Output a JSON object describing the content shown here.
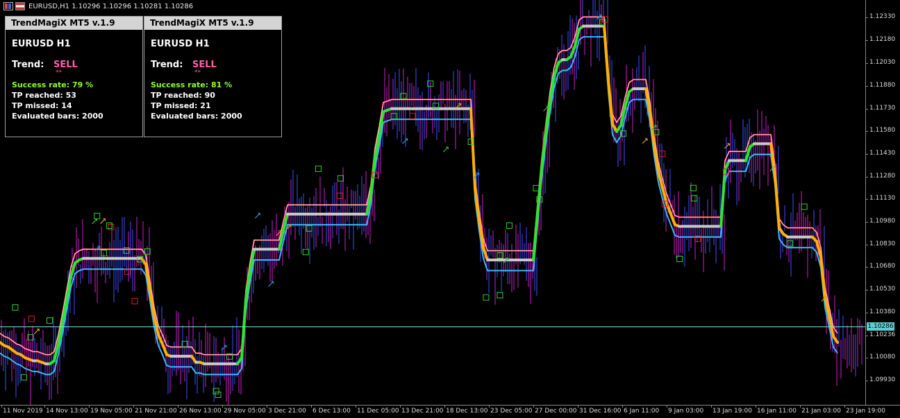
{
  "header": {
    "title": "EURUSD,H1  1.10296 1.10296 1.10281 1.10286"
  },
  "panels": [
    {
      "title": "TrendMagiX MT5 v.1.9",
      "symbol": "EURUSD H1",
      "trend_label": "Trend:",
      "trend_value": "SELL",
      "stars": "**",
      "success_rate": "Success rate: 79 %",
      "tp_reached": "TP reached: 53",
      "tp_missed": "TP missed:  14",
      "evaluated_bars": "Evaluated bars: 2000"
    },
    {
      "title": "TrendMagiX MT5 v.1.9",
      "symbol": "EURUSD H1",
      "trend_label": "Trend:",
      "trend_value": "SELL",
      "stars": "**",
      "success_rate": "Success rate: 81 %",
      "tp_reached": "TP reached: 90",
      "tp_missed": "TP missed:  21",
      "evaluated_bars": "Evaluated bars: 2000"
    }
  ],
  "price_axis": [
    "1.12330",
    "1.12180",
    "1.12030",
    "1.11880",
    "1.11730",
    "1.11580",
    "1.11430",
    "1.11280",
    "1.11130",
    "1.10980",
    "1.10830",
    "1.10680",
    "1.10530",
    "1.10380",
    "1.10236",
    "1.10080",
    "1.09930"
  ],
  "time_axis": [
    "11 Nov 2019",
    "14 Nov 13:00",
    "19 Nov 05:00",
    "21 Nov 21:00",
    "26 Nov 13:00",
    "29 Nov 05:00",
    "3 Dec 21:00",
    "6 Dec 13:00",
    "11 Dec 05:00",
    "13 Dec 21:00",
    "18 Dec 13:00",
    "23 Dec 05:00",
    "27 Dec 00:00",
    "31 Dec 16:00",
    "6 Jan 11:00",
    "9 Jan 03:00",
    "13 Jan 19:00",
    "16 Jan 11:00",
    "21 Jan 03:00",
    "23 Jan 19:00"
  ],
  "current_price": "1.10286",
  "colors": {
    "buy_line": "#2ee52e",
    "sell_line": "#ffb000",
    "neutral": "#c8c8c8",
    "band_up": "#3db8ff",
    "band_down": "#ff3a5a",
    "candle_up": "#4050ff",
    "candle_down": "#d020d0"
  },
  "chart_data": {
    "type": "line",
    "ylim": [
      1.0985,
      1.1239
    ],
    "x": [
      0,
      6,
      12,
      18,
      24,
      30,
      36,
      42,
      48,
      54,
      60,
      66,
      72,
      78,
      84,
      90,
      96,
      102,
      108,
      114,
      120,
      126,
      132,
      138,
      144,
      150,
      156,
      162,
      168,
      174,
      180,
      186,
      192,
      198,
      204,
      210,
      216,
      222,
      228,
      234,
      240,
      246,
      252,
      258,
      264,
      270,
      276,
      282,
      288,
      294,
      300,
      306,
      312,
      318,
      324,
      330,
      336,
      342,
      348,
      354,
      360,
      366,
      372,
      378,
      384,
      390,
      396,
      402,
      408,
      414,
      420,
      426,
      432,
      438,
      444,
      450,
      456,
      462,
      468,
      474,
      480,
      486,
      492,
      498,
      504,
      510,
      516,
      522,
      528,
      534,
      540,
      546,
      552,
      558,
      564,
      570,
      576,
      582,
      588,
      594,
      600,
      606,
      612,
      618,
      624,
      630,
      636,
      642,
      648,
      654,
      660,
      666,
      672,
      678,
      684,
      690,
      696,
      702,
      708,
      714,
      720,
      726,
      732,
      738,
      744,
      750,
      756,
      762,
      768,
      774,
      780,
      786,
      792,
      798,
      804,
      810,
      816,
      822,
      828,
      834,
      840,
      846,
      852,
      858,
      864,
      870,
      876,
      882,
      888,
      894,
      900,
      906,
      912,
      918,
      924,
      930,
      936,
      942,
      948,
      954,
      960,
      966,
      972,
      978,
      984,
      990,
      996,
      1002,
      1008,
      1014,
      1020,
      1026,
      1032,
      1038,
      1044,
      1050,
      1056,
      1062,
      1068,
      1074,
      1080,
      1086,
      1092,
      1098,
      1104,
      1110,
      1116,
      1122,
      1128,
      1134,
      1140,
      1146,
      1152,
      1158,
      1164,
      1170,
      1176,
      1182,
      1188,
      1194,
      1200,
      1206,
      1212,
      1218,
      1224,
      1230,
      1236,
      1242
    ],
    "series": [
      {
        "values": [
          1.1024,
          1.1022,
          1.1021,
          1.1019,
          1.1017,
          1.1016,
          1.1014,
          1.1013,
          1.1012,
          1.1012,
          1.1011,
          1.101,
          1.101,
          1.1012,
          1.1023,
          1.1037,
          1.1052,
          1.1067,
          1.1076,
          1.1078,
          1.1079,
          1.1079,
          1.1079,
          1.1079,
          1.1079,
          1.1079,
          1.1079,
          1.1079,
          1.1079,
          1.1079,
          1.1079,
          1.1079,
          1.1079,
          1.1079,
          1.1079,
          1.1075,
          1.1058,
          1.1041,
          1.1029,
          1.1023,
          1.1016,
          1.1015,
          1.1015,
          1.1015,
          1.1015,
          1.1015,
          1.1015,
          1.1011,
          1.1011,
          1.101,
          1.101,
          1.101,
          1.101,
          1.101,
          1.101,
          1.101,
          1.101,
          1.101,
          1.1014,
          1.1052,
          1.107,
          1.1085,
          1.1085,
          1.1085,
          1.1085,
          1.1085,
          1.1085,
          1.1085,
          1.1097,
          1.1108,
          1.1108,
          1.1108,
          1.1108,
          1.1108,
          1.1108,
          1.1108,
          1.1108,
          1.1108,
          1.1108,
          1.1108,
          1.1108,
          1.1108,
          1.1108,
          1.1108,
          1.1108,
          1.1108,
          1.1108,
          1.1108,
          1.1108,
          1.1121,
          1.1145,
          1.1159,
          1.1175,
          1.1176,
          1.1177,
          1.1177,
          1.1177,
          1.1177,
          1.1177,
          1.1177,
          1.1177,
          1.1177,
          1.1177,
          1.1177,
          1.1177,
          1.1177,
          1.1177,
          1.1177,
          1.1177,
          1.1177,
          1.1177,
          1.1177,
          1.1177,
          1.1177,
          1.1125,
          1.1104,
          1.1086,
          1.1078,
          1.1078,
          1.1078,
          1.1078,
          1.1078,
          1.1078,
          1.1078,
          1.1078,
          1.1078,
          1.1078,
          1.1078,
          1.1078,
          1.1108,
          1.1138,
          1.1161,
          1.1182,
          1.1198,
          1.1207,
          1.1209,
          1.1209,
          1.1211,
          1.1218,
          1.1229,
          1.1231,
          1.1231,
          1.1231,
          1.1231,
          1.1231,
          1.1231,
          1.1195,
          1.1167,
          1.1162,
          1.1166,
          1.1178,
          1.1188,
          1.119,
          1.119,
          1.119,
          1.119,
          1.1175,
          1.1153,
          1.1136,
          1.1125,
          1.1115,
          1.1108,
          1.1101,
          1.11,
          1.11,
          1.11,
          1.11,
          1.11,
          1.11,
          1.11,
          1.11,
          1.11,
          1.11,
          1.11,
          1.1137,
          1.1143,
          1.1143,
          1.1143,
          1.1143,
          1.1143,
          1.1152,
          1.1154,
          1.1154,
          1.1154,
          1.1154,
          1.1154,
          1.1134,
          1.1099,
          1.1095,
          1.1093,
          1.1093,
          1.1093,
          1.1093,
          1.1093,
          1.1093,
          1.1093,
          1.109,
          1.108,
          1.1054,
          1.1041,
          1.1028,
          1.1024
        ]
      }
    ]
  }
}
